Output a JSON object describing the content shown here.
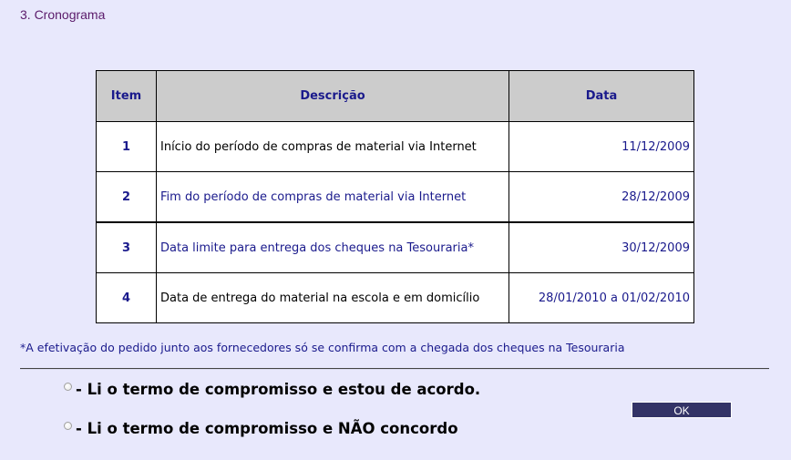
{
  "section": {
    "title": "3. Cronograma"
  },
  "table": {
    "headers": {
      "item": "Item",
      "description": "Descrição",
      "date": "Data"
    },
    "rows": [
      {
        "item": "1",
        "description": "Início do período de compras de material via Internet",
        "date": "11/12/2009"
      },
      {
        "item": "2",
        "description": "Fim do período de compras de material via Internet",
        "date": "28/12/2009"
      },
      {
        "item": "3",
        "description": "Data limite para entrega dos cheques na Tesouraria*",
        "date": "30/12/2009"
      },
      {
        "item": "4",
        "description": "Data de entrega do material na escola e em domicílio",
        "date": "28/01/2010 a 01/02/2010"
      }
    ]
  },
  "footnote": "*A efetivação do pedido junto aos fornecedores só se confirma com a chegada dos cheques na Tesouraria",
  "options": [
    {
      "label": "- Li o termo de compromisso e estou de acordo.",
      "checked": false
    },
    {
      "label": "- Li o termo de compromisso e NÃO concordo",
      "checked": false
    }
  ],
  "ok_button": {
    "label": "OK"
  },
  "colors": {
    "background": "#e8e8fc",
    "title": "#5a1a6a",
    "table_header_bg": "#cccccc",
    "accent_text": "#1a1a8c",
    "button_bg": "#333366"
  }
}
